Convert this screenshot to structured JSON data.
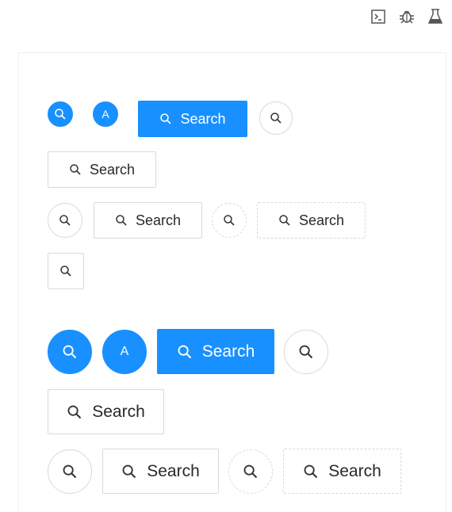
{
  "toolbar": {
    "icons": [
      "terminal-icon",
      "bug-icon",
      "experiment-icon"
    ]
  },
  "buttons": {
    "search_label": "Search",
    "avatar_letter": "A"
  },
  "colors": {
    "primary": "#1890ff",
    "border": "#d9d9d9",
    "text": "rgba(0,0,0,0.85)"
  }
}
